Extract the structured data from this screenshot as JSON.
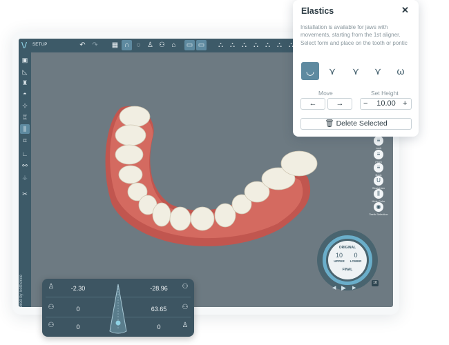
{
  "app": {
    "logo": "\\/",
    "section": "SETUP",
    "brand": "Powered by SoftSmile"
  },
  "toolbar": {
    "icons": [
      "undo-icon",
      "redo-icon",
      "grid-icon",
      "arch-icon",
      "lasso-icon",
      "tooth-icon",
      "teeth-icon",
      "view-icon",
      "upper-jaw-icon",
      "lower-jaw-icon"
    ]
  },
  "right_tools": {
    "labels": [
      "Lock",
      "Front",
      "Back",
      "Straighten",
      "Hide Color",
      "Teeth Selection"
    ]
  },
  "dial": {
    "original": "ORIGINAL",
    "upper_value": "10",
    "lower_value": "0",
    "upper_label": "UPPER",
    "lower_label": "LOWER",
    "final": "FINAL",
    "end_value": "10"
  },
  "movement_panel": {
    "rows": [
      {
        "left": "-2.30",
        "right": "-28.96"
      },
      {
        "left": "0",
        "right": "63.65"
      },
      {
        "left": "0",
        "right": "0"
      }
    ]
  },
  "elastics": {
    "title": "Elastics",
    "description": "Installation is available for jaws with movements, starting from the 1st aligner. Select form and place on the tooth or pontic",
    "move_label": "Move",
    "set_height_label": "Set Height",
    "height_value": "10.00",
    "minus": "−",
    "plus": "+",
    "left_arrow": "←",
    "right_arrow": "→",
    "delete_label": "Delete Selected"
  },
  "colors": {
    "accent": "#5e8aa0",
    "toolbar": "#3d5a68",
    "viewport": "#6d7a82",
    "gum": "#c1564f",
    "tooth": "#f0ece0"
  }
}
